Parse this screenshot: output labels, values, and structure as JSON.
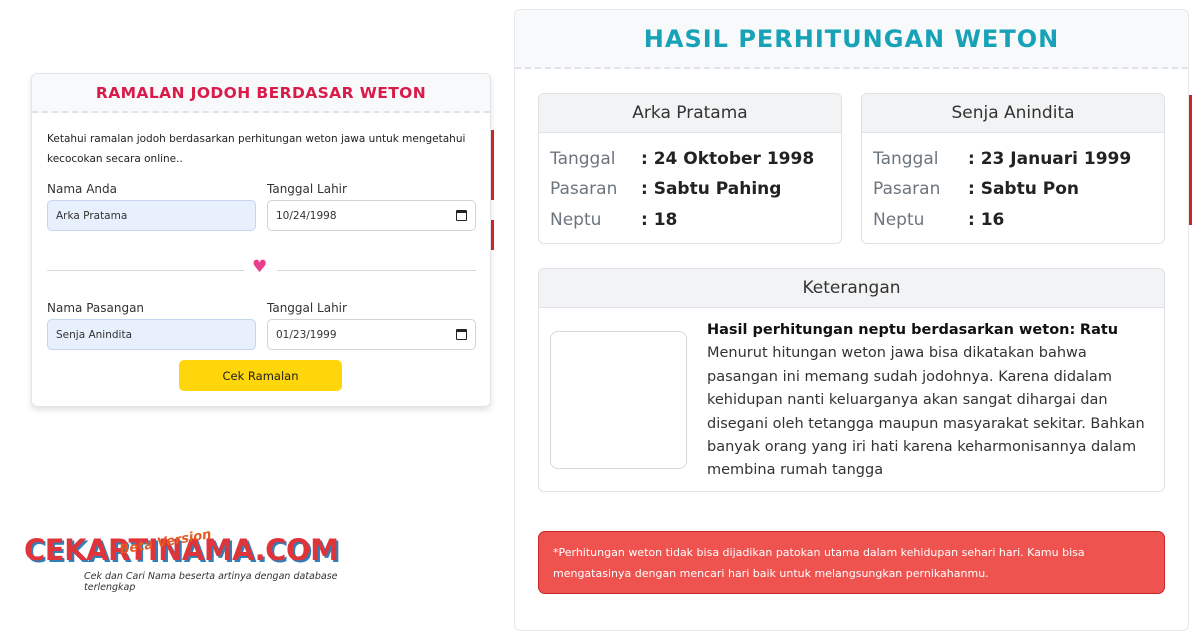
{
  "form": {
    "title": "RAMALAN JODOH BERDASAR WETON",
    "intro_line1": "Ketahui ramalan jodoh berdasarkan perhitungan weton jawa untuk mengetahui",
    "intro_line2": "kecocokan secara online..",
    "name_label": "Nama Anda",
    "name_value": "Arka Pratama",
    "dob_label": "Tanggal Lahir",
    "dob_value": "10/24/1998",
    "partner_label": "Nama Pasangan",
    "partner_value": "Senja Anindita",
    "partner_dob_label": "Tanggal Lahir",
    "partner_dob_value": "01/23/1999",
    "submit_label": "Cek Ramalan"
  },
  "logo": {
    "text": "CEKARTINAMA.COM",
    "badge": "Beta Version",
    "tagline": "Cek dan Cari Nama beserta artinya dengan database terlengkap"
  },
  "result": {
    "title": "HASIL PERHITUNGAN WETON",
    "person1": {
      "name": "Arka Pratama",
      "tanggal_label": "Tanggal",
      "tanggal_value": ": 24 Oktober 1998",
      "pasaran_label": "Pasaran",
      "pasaran_value": ": Sabtu Pahing",
      "neptu_label": "Neptu",
      "neptu_value": ": 18"
    },
    "person2": {
      "name": "Senja Anindita",
      "tanggal_label": "Tanggal",
      "tanggal_value": ": 23 Januari 1999",
      "pasaran_label": "Pasaran",
      "pasaran_value": ": Sabtu Pon",
      "neptu_label": "Neptu",
      "neptu_value": ": 16"
    },
    "keterangan": {
      "title": "Keterangan",
      "lead": "Hasil perhitungan neptu berdasarkan weton:",
      "verdict": "Ratu",
      "body": "Menurut hitungan weton jawa bisa dikatakan bahwa pasangan ini memang sudah jodohnya. Karena didalam kehidupan nanti keluarganya akan sangat dihargai dan disegani oleh tetangga maupun masyarakat sekitar. Bahkan banyak orang yang iri hati karena keharmonisannya dalam membina rumah tangga"
    },
    "warning": "*Perhitungan weton tidak bisa dijadikan patokan utama dalam kehidupan sehari hari. Kamu bisa mengatasinya dengan mencari hari baik untuk melangsungkan pernikahanmu."
  },
  "colors": {
    "form_title": "#d81b48",
    "result_title": "#17a2b8",
    "button": "#ffd60a",
    "warning_bg": "#ef5350",
    "heart": "#e83e8c"
  }
}
